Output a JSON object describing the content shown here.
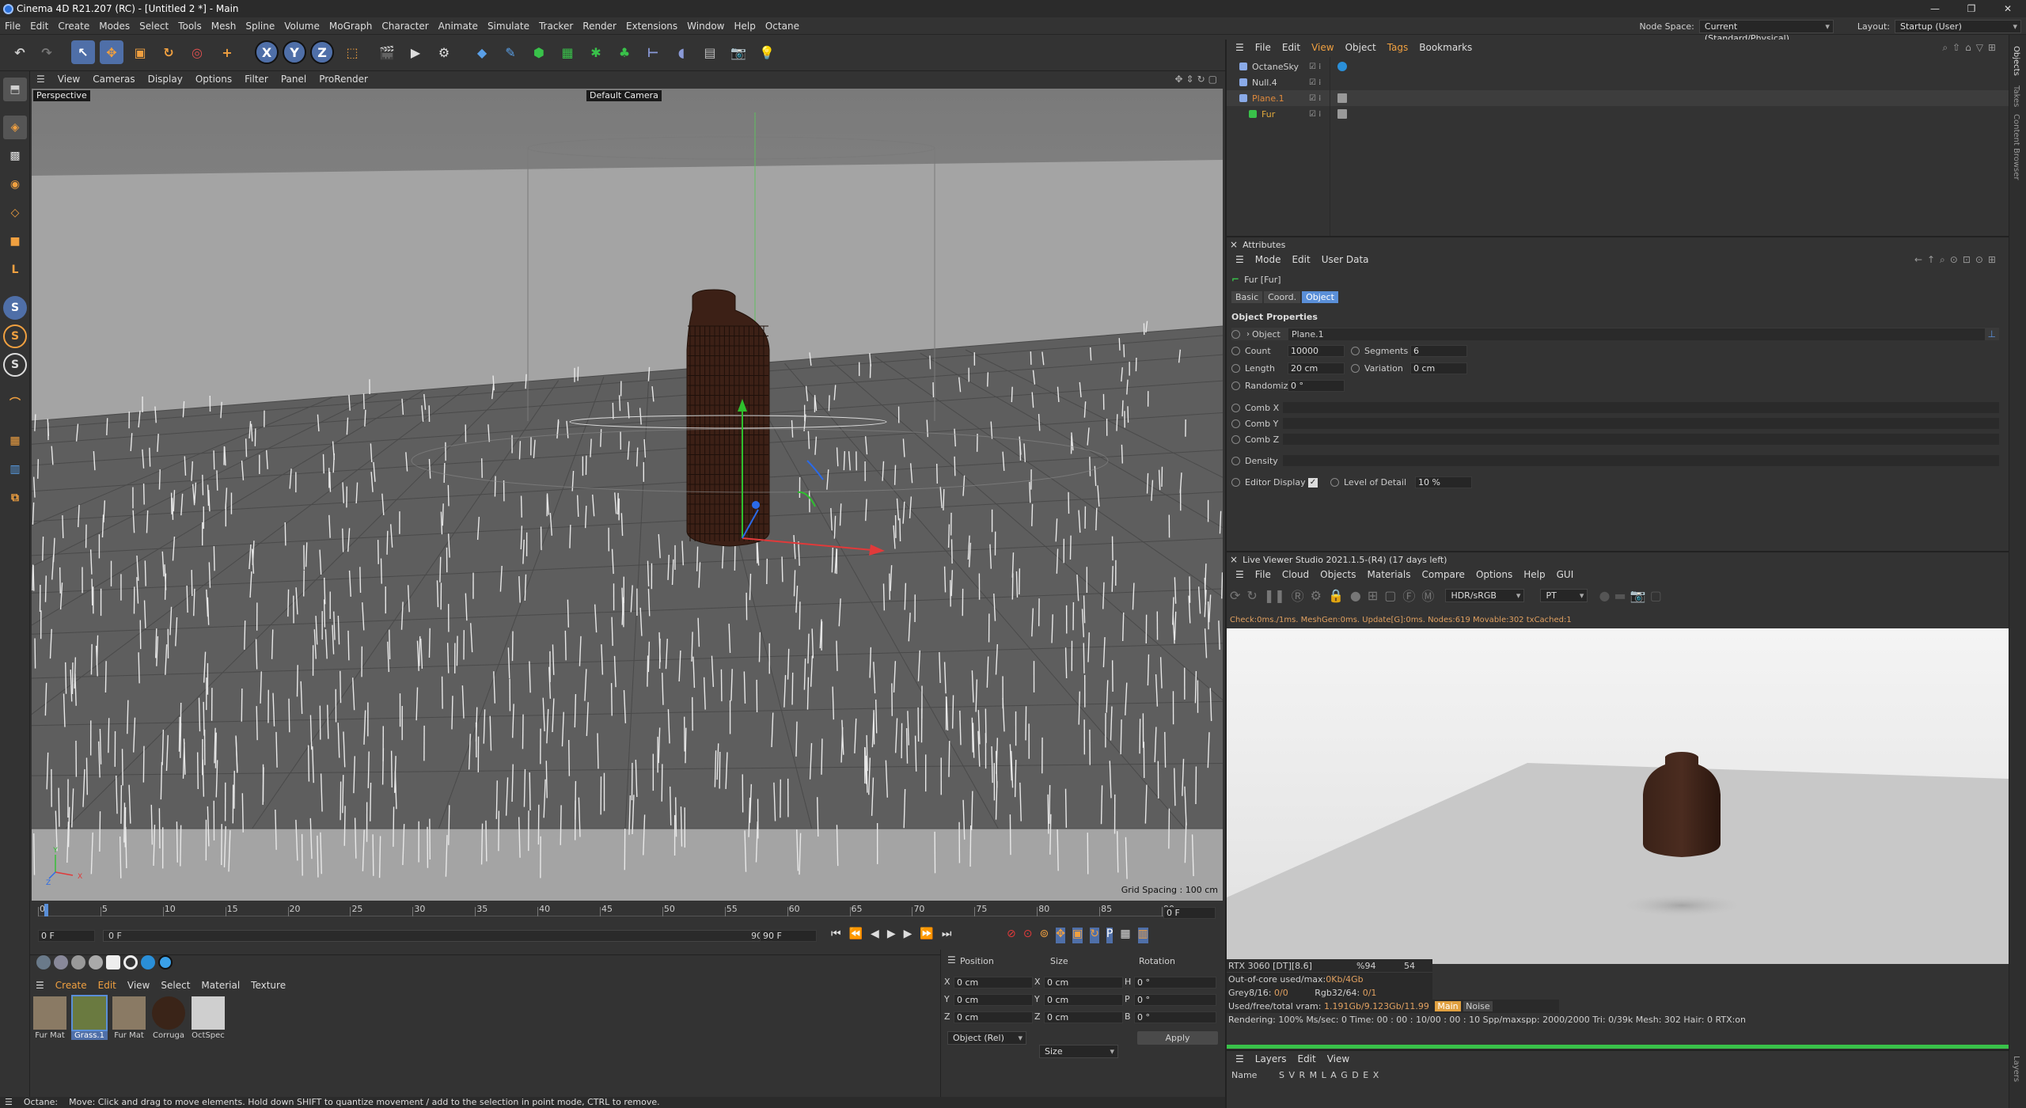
{
  "titlebar": {
    "title": "Cinema 4D R21.207 (RC) - [Untitled 2 *] - Main"
  },
  "menubar": {
    "items": [
      "File",
      "Edit",
      "Create",
      "Modes",
      "Select",
      "Tools",
      "Mesh",
      "Spline",
      "Volume",
      "MoGraph",
      "Character",
      "Animate",
      "Simulate",
      "Tracker",
      "Render",
      "Extensions",
      "Window",
      "Help",
      "Octane"
    ],
    "node_space_label": "Node Space:",
    "node_space_value": "Current (Standard/Physical)",
    "layout_label": "Layout:",
    "layout_value": "Startup (User)"
  },
  "toolbar": {
    "axis_x": "X",
    "axis_y": "Y",
    "axis_z": "Z"
  },
  "viewport": {
    "menu": [
      "View",
      "Cameras",
      "Display",
      "Options",
      "Filter",
      "Panel",
      "ProRender"
    ],
    "view_name": "Perspective",
    "camera": "Default Camera",
    "grid_spacing": "Grid Spacing : 100 cm",
    "axis_y": "Y",
    "axis_x": "X",
    "axis_z": "Z"
  },
  "timeline": {
    "ticks": [
      "0",
      "5",
      "10",
      "15",
      "20",
      "25",
      "30",
      "35",
      "40",
      "45",
      "50",
      "55",
      "60",
      "65",
      "70",
      "75",
      "80",
      "85",
      "90"
    ],
    "current_frame": "0 F",
    "start_frame": "0 F",
    "start_frame2": "0 F",
    "end_frame": "90 F",
    "end_frame2": "90 F"
  },
  "materials": {
    "menu": [
      "Create",
      "Edit",
      "View",
      "Select",
      "Material",
      "Texture"
    ],
    "items": [
      {
        "name": "Fur Mat",
        "color": "#8a7a64"
      },
      {
        "name": "Grass.1",
        "color": "#6a7a40"
      },
      {
        "name": "Fur Mat",
        "color": "#8a7a64"
      },
      {
        "name": "Corruga",
        "color": "#3a2418"
      },
      {
        "name": "OctSpec",
        "color": "#cfcfcf"
      }
    ]
  },
  "coords": {
    "headers": {
      "position": "Position",
      "size": "Size",
      "rotation": "Rotation"
    },
    "rows": [
      {
        "axis": "X",
        "pos": "0 cm",
        "saxis": "X",
        "size": "0 cm",
        "raxis": "H",
        "rot": "0 °"
      },
      {
        "axis": "Y",
        "pos": "0 cm",
        "saxis": "Y",
        "size": "0 cm",
        "raxis": "P",
        "rot": "0 °"
      },
      {
        "axis": "Z",
        "pos": "0 cm",
        "saxis": "Z",
        "size": "0 cm",
        "raxis": "B",
        "rot": "0 °"
      }
    ],
    "mode": "Object (Rel)",
    "size_mode": "Size",
    "apply": "Apply"
  },
  "status": {
    "app": "Octane:",
    "message": "Move: Click and drag to move elements. Hold down SHIFT to quantize movement / add to the selection in point mode, CTRL to remove."
  },
  "objects": {
    "menu": [
      "File",
      "Edit",
      "View",
      "Object",
      "Tags",
      "Bookmarks"
    ],
    "items": [
      {
        "name": "OctaneSky",
        "color": "#cfcfcf"
      },
      {
        "name": "Null.4",
        "color": "#cfcfcf"
      },
      {
        "name": "Plane.1",
        "color": "#e08a3c"
      },
      {
        "name": "Fur",
        "color": "#e0a83c"
      }
    ]
  },
  "attributes": {
    "title": "Attributes",
    "menu": [
      "Mode",
      "Edit",
      "User Data"
    ],
    "object_name": "Fur [Fur]",
    "tabs": [
      "Basic",
      "Coord.",
      "Object"
    ],
    "section": "Object Properties",
    "object_label": "Object",
    "object_value": "Plane.1",
    "count_label": "Count",
    "count_value": "10000",
    "segments_label": "Segments",
    "segments_value": "6",
    "length_label": "Length",
    "length_value": "20 cm",
    "variation_label": "Variation",
    "variation_value": "0 cm",
    "randomize_label": "Randomize",
    "randomize_value": "0 °",
    "comb_x": "Comb X",
    "comb_y": "Comb Y",
    "comb_z": "Comb Z",
    "density": "Density",
    "editor_display": "Editor Display",
    "lod_label": "Level of Detail",
    "lod_value": "10 %"
  },
  "liveviewer": {
    "title": "Live Viewer Studio 2021.1.5-(R4) (17 days left)",
    "menu": [
      "File",
      "Cloud",
      "Objects",
      "Materials",
      "Compare",
      "Options",
      "Help",
      "GUI"
    ],
    "colorspace": "HDR/sRGB",
    "mode": "PT",
    "log": "Check:0ms./1ms. MeshGen:0ms. Update[G]:0ms. Nodes:619 Movable:302 txCached:1",
    "gpu": "RTX 3060 [DT][8.6]",
    "gpu_pct": "%94",
    "gpu_temp": "54",
    "ooc": "Out-of-core used/max:",
    "ooc_val": "0Kb/4Gb",
    "grey": "Grey8/16: ",
    "grey_val": "0/0",
    "rgb": "Rgb32/64: ",
    "rgb_val": "0/1",
    "vram": "Used/free/total vram: ",
    "vram_val": "1.191Gb/9.123Gb/11.99",
    "tag_main": "Main",
    "tag_noise": "Noise",
    "render_line": "Rendering: 100% Ms/sec: 0   Time: 00 : 00 : 10/00 : 00 : 10    Spp/maxspp: 2000/2000    Tri: 0/39k    Mesh: 302    Hair: 0    RTX:on"
  },
  "layers": {
    "menu": [
      "Layers",
      "Edit",
      "View"
    ],
    "name_col": "Name",
    "cols": "S V R M L A G D E X"
  },
  "side_tabs": [
    "Objects",
    "Takes",
    "Content Browser",
    "Layers"
  ],
  "colors": {
    "accent": "#5a8fd8",
    "orange": "#e08a3c",
    "green": "#39c24a",
    "sel": "#4f6fa8"
  }
}
